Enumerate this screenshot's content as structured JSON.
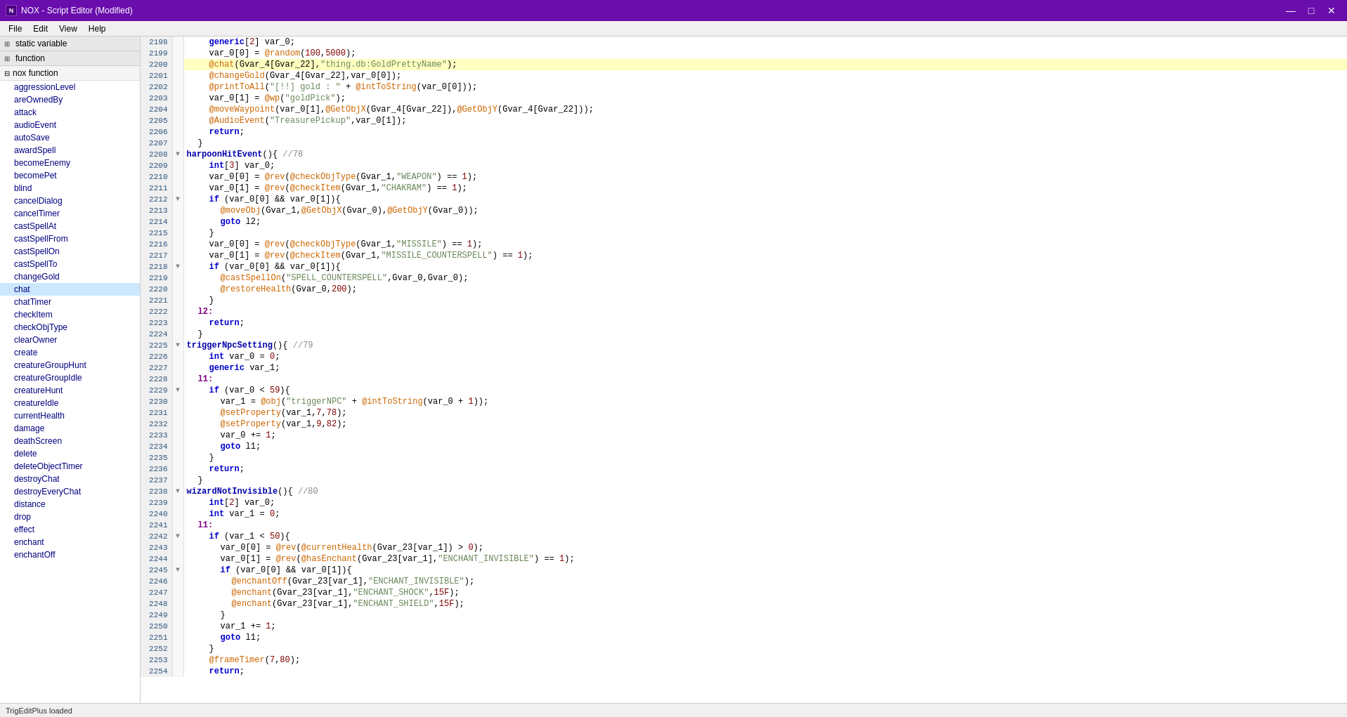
{
  "titleBar": {
    "icon": "N",
    "title": "NOX - Script Editor (Modified)",
    "buttons": [
      "—",
      "☐",
      "✕"
    ]
  },
  "menuBar": {
    "items": [
      "File",
      "Edit",
      "View",
      "Help"
    ]
  },
  "sidebar": {
    "staticVariable": {
      "label": "static variable",
      "expanded": true
    },
    "function": {
      "label": "function",
      "expanded": false
    },
    "noxFunction": {
      "label": "nox function",
      "expanded": true
    },
    "noxItems": [
      "aggressionLevel",
      "areOwnedBy",
      "attack",
      "audioEvent",
      "autoSave",
      "awardSpell",
      "becomeEnemy",
      "becomePet",
      "blind",
      "cancelDialog",
      "cancelTimer",
      "castSpellAt",
      "castSpellFrom",
      "castSpellOn",
      "castSpellTo",
      "changeGold",
      "chat",
      "chatTimer",
      "checkItem",
      "checkObjType",
      "clearOwner",
      "create",
      "creatureGroupHunt",
      "creatureGroupIdle",
      "creatureHunt",
      "creatureIdle",
      "currentHealth",
      "damage",
      "deathScreen",
      "delete",
      "deleteObjectTimer",
      "destroyChat",
      "destroyEveryChat",
      "distance",
      "drop",
      "effect",
      "enchant",
      "enchantOff"
    ]
  },
  "statusBar": {
    "text": "TrigEditPlus loaded"
  },
  "codeLines": [
    {
      "num": 2198,
      "fold": "",
      "indent": 2,
      "code": "generic[2] var_0;"
    },
    {
      "num": 2199,
      "fold": "",
      "indent": 2,
      "code": "var_0[0] = @random(100,5000);"
    },
    {
      "num": 2200,
      "fold": "",
      "indent": 2,
      "code": "@chat(Gvar_4[Gvar_22],\"thing.db:GoldPrettyName\");"
    },
    {
      "num": 2201,
      "fold": "",
      "indent": 2,
      "code": "@changeGold(Gvar_4[Gvar_22],var_0[0]);"
    },
    {
      "num": 2202,
      "fold": "",
      "indent": 2,
      "code": "@printToAll(\"[!!] gold : \" + @intToString(var_0[0]));"
    },
    {
      "num": 2203,
      "fold": "",
      "indent": 2,
      "code": "var_0[1] = @wp(\"goldPick\");"
    },
    {
      "num": 2204,
      "fold": "",
      "indent": 2,
      "code": "@moveWaypoint(var_0[1],@GetObjX(Gvar_4[Gvar_22]),@GetObjY(Gvar_4[Gvar_22]));"
    },
    {
      "num": 2205,
      "fold": "",
      "indent": 2,
      "code": "@AudioEvent(\"TreasurePickup\",var_0[1]);"
    },
    {
      "num": 2206,
      "fold": "",
      "indent": 2,
      "code": "return;"
    },
    {
      "num": 2207,
      "fold": "",
      "indent": 1,
      "code": "}"
    },
    {
      "num": 2208,
      "fold": "▼",
      "indent": 0,
      "code": "harpoonHitEvent(){ //78"
    },
    {
      "num": 2209,
      "fold": "",
      "indent": 2,
      "code": "int[3] var_0;"
    },
    {
      "num": 2210,
      "fold": "",
      "indent": 2,
      "code": "var_0[0] = @rev(@checkObjType(Gvar_1,\"WEAPON\") == 1);"
    },
    {
      "num": 2211,
      "fold": "",
      "indent": 2,
      "code": "var_0[1] = @rev(@checkItem(Gvar_1,\"CHAKRAM\") == 1);"
    },
    {
      "num": 2212,
      "fold": "▼",
      "indent": 2,
      "code": "if (var_0[0] && var_0[1]){"
    },
    {
      "num": 2213,
      "fold": "",
      "indent": 3,
      "code": "@moveObj(Gvar_1,@GetObjX(Gvar_0),@GetObjY(Gvar_0));"
    },
    {
      "num": 2214,
      "fold": "",
      "indent": 3,
      "code": "goto l2;"
    },
    {
      "num": 2215,
      "fold": "",
      "indent": 2,
      "code": "}"
    },
    {
      "num": 2216,
      "fold": "",
      "indent": 2,
      "code": "var_0[0] = @rev(@checkObjType(Gvar_1,\"MISSILE\") == 1);"
    },
    {
      "num": 2217,
      "fold": "",
      "indent": 2,
      "code": "var_0[1] = @rev(@checkItem(Gvar_1,\"MISSILE_COUNTERSPELL\") == 1);"
    },
    {
      "num": 2218,
      "fold": "▼",
      "indent": 2,
      "code": "if (var_0[0] && var_0[1]){"
    },
    {
      "num": 2219,
      "fold": "",
      "indent": 3,
      "code": "@castSpellOn(\"SPELL_COUNTERSPELL\",Gvar_0,Gvar_0);"
    },
    {
      "num": 2220,
      "fold": "",
      "indent": 3,
      "code": "@restoreHealth(Gvar_0,200);"
    },
    {
      "num": 2221,
      "fold": "",
      "indent": 2,
      "code": "}"
    },
    {
      "num": 2222,
      "fold": "",
      "indent": 1,
      "code": "l2:"
    },
    {
      "num": 2223,
      "fold": "",
      "indent": 2,
      "code": "return;"
    },
    {
      "num": 2224,
      "fold": "",
      "indent": 1,
      "code": "}"
    },
    {
      "num": 2225,
      "fold": "▼",
      "indent": 0,
      "code": "triggerNpcSetting(){ //79"
    },
    {
      "num": 2226,
      "fold": "",
      "indent": 2,
      "code": "int var_0 = 0;"
    },
    {
      "num": 2227,
      "fold": "",
      "indent": 2,
      "code": "generic var_1;"
    },
    {
      "num": 2228,
      "fold": "",
      "indent": 1,
      "code": "l1:"
    },
    {
      "num": 2229,
      "fold": "▼",
      "indent": 2,
      "code": "if (var_0 < 59){"
    },
    {
      "num": 2230,
      "fold": "",
      "indent": 3,
      "code": "var_1 = @obj(\"triggerNPC\" + @intToString(var_0 + 1));"
    },
    {
      "num": 2231,
      "fold": "",
      "indent": 3,
      "code": "@setProperty(var_1,7,78);"
    },
    {
      "num": 2232,
      "fold": "",
      "indent": 3,
      "code": "@setProperty(var_1,9,82);"
    },
    {
      "num": 2233,
      "fold": "",
      "indent": 3,
      "code": "var_0 += 1;"
    },
    {
      "num": 2234,
      "fold": "",
      "indent": 3,
      "code": "goto l1;"
    },
    {
      "num": 2235,
      "fold": "",
      "indent": 2,
      "code": "}"
    },
    {
      "num": 2236,
      "fold": "",
      "indent": 2,
      "code": "return;"
    },
    {
      "num": 2237,
      "fold": "",
      "indent": 1,
      "code": "}"
    },
    {
      "num": 2238,
      "fold": "▼",
      "indent": 0,
      "code": "wizardNotInvisible(){ //80"
    },
    {
      "num": 2239,
      "fold": "",
      "indent": 2,
      "code": "int[2] var_0;"
    },
    {
      "num": 2240,
      "fold": "",
      "indent": 2,
      "code": "int var_1 = 0;"
    },
    {
      "num": 2241,
      "fold": "",
      "indent": 1,
      "code": "l1:"
    },
    {
      "num": 2242,
      "fold": "▼",
      "indent": 2,
      "code": "if (var_1 < 50){"
    },
    {
      "num": 2243,
      "fold": "",
      "indent": 3,
      "code": "var_0[0] = @rev(@currentHealth(Gvar_23[var_1]) > 0);"
    },
    {
      "num": 2244,
      "fold": "",
      "indent": 3,
      "code": "var_0[1] = @rev(@hasEnchant(Gvar_23[var_1],\"ENCHANT_INVISIBLE\") == 1);"
    },
    {
      "num": 2245,
      "fold": "▼",
      "indent": 3,
      "code": "if (var_0[0] && var_0[1]){"
    },
    {
      "num": 2246,
      "fold": "",
      "indent": 4,
      "code": "@enchantOff(Gvar_23[var_1],\"ENCHANT_INVISIBLE\");"
    },
    {
      "num": 2247,
      "fold": "",
      "indent": 4,
      "code": "@enchant(Gvar_23[var_1],\"ENCHANT_SHOCK\",15F);"
    },
    {
      "num": 2248,
      "fold": "",
      "indent": 4,
      "code": "@enchant(Gvar_23[var_1],\"ENCHANT_SHIELD\",15F);"
    },
    {
      "num": 2249,
      "fold": "",
      "indent": 3,
      "code": "}"
    },
    {
      "num": 2250,
      "fold": "",
      "indent": 3,
      "code": "var_1 += 1;"
    },
    {
      "num": 2251,
      "fold": "",
      "indent": 3,
      "code": "goto l1;"
    },
    {
      "num": 2252,
      "fold": "",
      "indent": 2,
      "code": "}"
    },
    {
      "num": 2253,
      "fold": "",
      "indent": 2,
      "code": "@frameTimer(7,80);"
    },
    {
      "num": 2254,
      "fold": "",
      "indent": 2,
      "code": "return;"
    }
  ]
}
